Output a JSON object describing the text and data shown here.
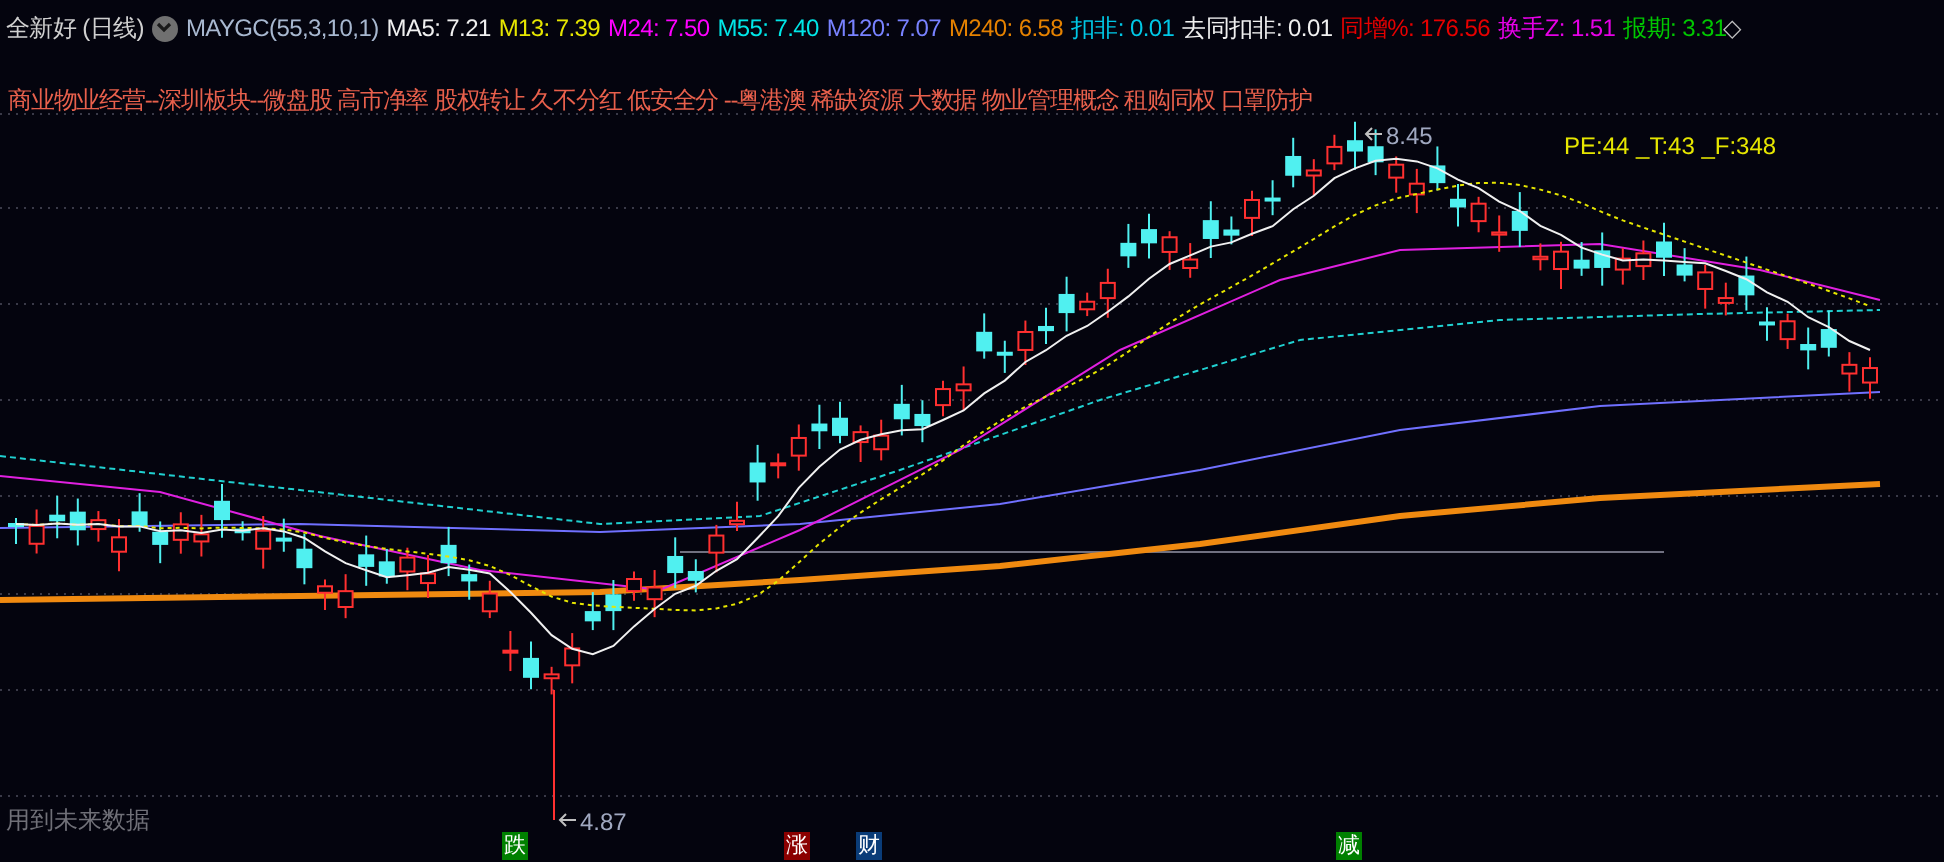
{
  "header": {
    "title": "全新好 (日线)",
    "indicator_name": "MAYGC(55,3,10,1)",
    "indicators": [
      {
        "label": "MA5:",
        "value": "7.21",
        "color": "#f0f0f0"
      },
      {
        "label": "M13:",
        "value": "7.39",
        "color": "#e6e600"
      },
      {
        "label": "M24:",
        "value": "7.50",
        "color": "#ff00ff"
      },
      {
        "label": "M55:",
        "value": "7.40",
        "color": "#00e6e6"
      },
      {
        "label": "M120:",
        "value": "7.07",
        "color": "#7882ff"
      },
      {
        "label": "M240:",
        "value": "6.58",
        "color": "#e68200"
      },
      {
        "label": "扣非:",
        "value": "0.01",
        "color": "#00c8e6"
      },
      {
        "label": "去同扣非:",
        "value": "0.01",
        "color": "#f0f0f0"
      },
      {
        "label": "同增%:",
        "value": "176.56",
        "color": "#e60000"
      },
      {
        "label": "换手Z:",
        "value": "1.51",
        "color": "#e600e6"
      },
      {
        "label": "报期:",
        "value": "3.31",
        "color": "#00c800"
      }
    ],
    "end_mark": "◇"
  },
  "concepts": "商业物业经营--深圳板块--微盘股 高市净率 股权转让 久不分红 低安全分 --粤港澳 稀缺资源 大数据 物业管理概念 租购同权 口罩防护",
  "valuation": "PE:44 _T:43 _F:348",
  "high_label": "8.45",
  "low_label": "4.87",
  "note": "用到未来数据",
  "events": [
    {
      "label": "跌",
      "color": "#008000"
    },
    {
      "label": "涨",
      "color": "#8b0000"
    },
    {
      "label": "财",
      "color": "#0a3c78"
    },
    {
      "label": "减",
      "color": "#008000"
    }
  ]
}
